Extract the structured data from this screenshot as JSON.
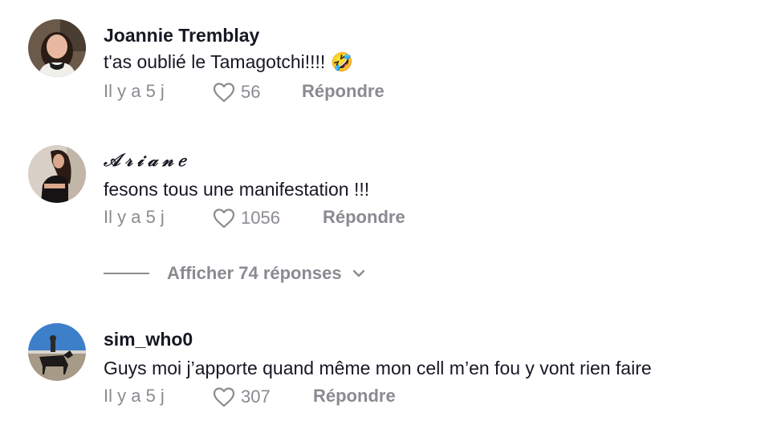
{
  "comments": [
    {
      "username": "Joannie Tremblay",
      "text": "t'as oublié le Tamagotchi!!!! 🤣",
      "time": "Il y a 5 j",
      "likes": "56",
      "reply_label": "Répondre",
      "avatar_icon": "avatar-photo-woman"
    },
    {
      "username": "𝒜𝓇𝒾𝒶𝓃𝑒",
      "text": "fesons tous une manifestation !!!",
      "time": "Il y a 5 j",
      "likes": "1056",
      "reply_label": "Répondre",
      "avatar_icon": "avatar-photo-woman"
    },
    {
      "username": "sim_who0",
      "text": "Guys moi j’apporte quand même mon cell m’en fou y vont rien faire",
      "time": "Il y a 5 j",
      "likes": "307",
      "reply_label": "Répondre",
      "avatar_icon": "avatar-photo-horse-rider"
    }
  ],
  "replies_toggle": {
    "label": "Afficher 74 réponses",
    "icon": "chevron-down-icon"
  },
  "colors": {
    "text": "#161823",
    "muted": "#8a8b91",
    "background": "#ffffff"
  }
}
